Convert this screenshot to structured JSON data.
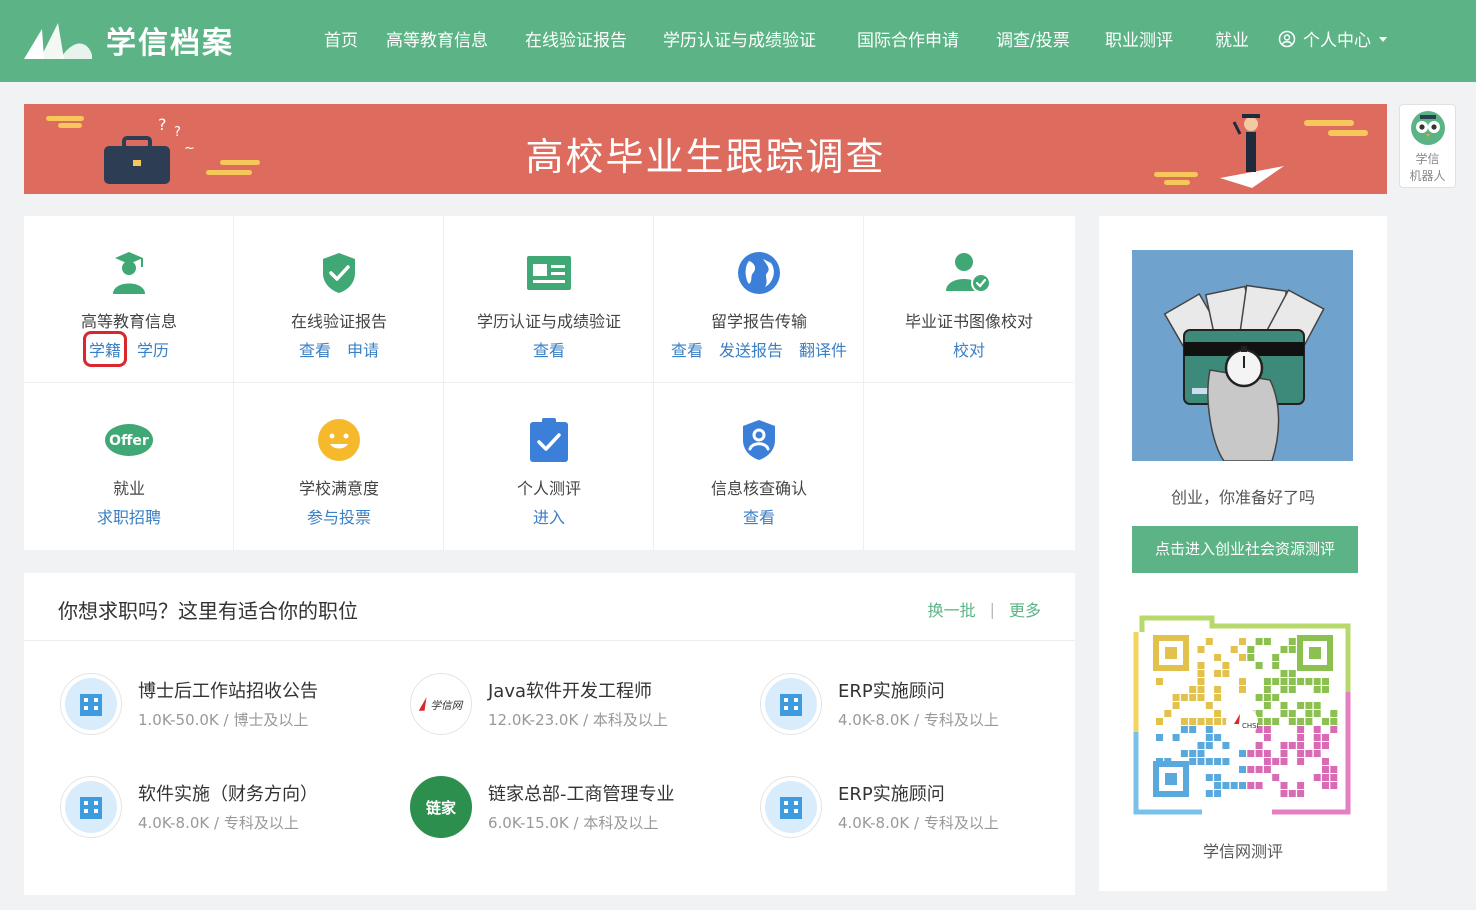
{
  "header": {
    "logo_text": "学信档案",
    "nav": [
      "首页",
      "高等教育信息",
      "在线验证报告",
      "学历认证与成绩验证",
      "国际合作申请",
      "调查/投票",
      "职业测评",
      "就业"
    ],
    "user_menu": "个人中心"
  },
  "banner": {
    "title": "高校毕业生跟踪调查"
  },
  "robot": {
    "line1": "学信",
    "line2": "机器人"
  },
  "services": {
    "edu": {
      "title": "高等教育信息",
      "links": [
        "学籍",
        "学历"
      ]
    },
    "report": {
      "title": "在线验证报告",
      "links": [
        "查看",
        "申请"
      ]
    },
    "cert": {
      "title": "学历认证与成绩验证",
      "links": [
        "查看"
      ]
    },
    "abroad": {
      "title": "留学报告传输",
      "links": [
        "查看",
        "发送报告",
        "翻译件"
      ]
    },
    "diploma": {
      "title": "毕业证书图像校对",
      "links": [
        "校对"
      ]
    },
    "job": {
      "title": "就业",
      "links": [
        "求职招聘"
      ],
      "icon_text": "Offer"
    },
    "satisfaction": {
      "title": "学校满意度",
      "links": [
        "参与投票"
      ]
    },
    "eval": {
      "title": "个人测评",
      "links": [
        "进入"
      ]
    },
    "verify": {
      "title": "信息核查确认",
      "links": [
        "查看"
      ]
    }
  },
  "jobs": {
    "title": "你想求职吗？这里有适合你的职位",
    "refresh": "换一批",
    "separator": "|",
    "more": "更多",
    "items": [
      {
        "name": "博士后工作站招收公告",
        "salary": "1.0K-50.0K",
        "edu": "博士及以上"
      },
      {
        "name": "Java软件开发工程师",
        "salary": "12.0K-23.0K",
        "edu": "本科及以上",
        "logo_text": "学信网"
      },
      {
        "name": "ERP实施顾问",
        "salary": "4.0K-8.0K",
        "edu": "专科及以上"
      },
      {
        "name": "软件实施（财务方向）",
        "salary": "4.0K-8.0K",
        "edu": "专科及以上"
      },
      {
        "name": "链家总部-工商管理专业",
        "salary": "6.0K-15.0K",
        "edu": "本科及以上",
        "logo_text": "链家"
      },
      {
        "name": "ERP实施顾问",
        "salary": "4.0K-8.0K",
        "edu": "专科及以上"
      }
    ],
    "meta_separator": " / "
  },
  "sidebar": {
    "ad_text": "创业，你准备好了吗",
    "ad_button": "点击进入创业社会资源测评",
    "qr_label": "学信网测评",
    "qr_inner_text": "CHSI"
  },
  "colors": {
    "brand_green": "#5cb486",
    "banner_red": "#dd6b5e",
    "link_blue": "#3b7fc4",
    "highlight_red": "#d9272d"
  }
}
